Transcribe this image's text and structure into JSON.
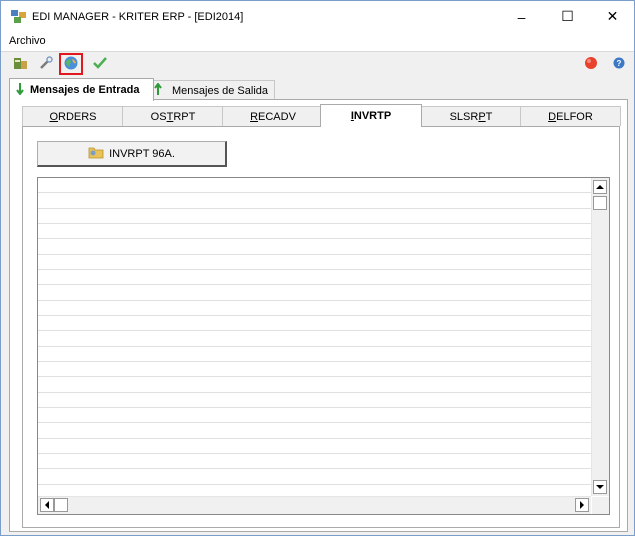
{
  "window": {
    "title": "EDI MANAGER - KRITER ERP - [EDI2014]",
    "minimize": "–",
    "maximize": "☐",
    "close": "✕"
  },
  "menu": {
    "items": [
      {
        "label": "Archivo"
      }
    ]
  },
  "toolbar": {
    "buttons": [
      {
        "icon": "database-export-icon"
      },
      {
        "icon": "wrench-icon"
      },
      {
        "icon": "globe-refresh-icon",
        "highlighted": true
      },
      {
        "icon": "checkmark-icon"
      },
      {
        "icon": "red-record-icon"
      },
      {
        "icon": "help-icon"
      }
    ]
  },
  "outer_tabs": [
    {
      "label": "Mensajes de Entrada",
      "icon": "green-arrow-down-icon",
      "active": true
    },
    {
      "label": "Mensajes de Salida",
      "icon": "green-arrow-up-icon",
      "active": false
    }
  ],
  "inner_tabs": [
    {
      "label": "ORDERS",
      "mnemonic": "O",
      "rest": "RDERS",
      "active": false
    },
    {
      "label": "OSTRPT",
      "pre": "OS",
      "mnemonic": "T",
      "rest": "RPT",
      "active": false
    },
    {
      "label": "RECADV",
      "mnemonic": "R",
      "rest": "ECADV",
      "active": false
    },
    {
      "label": "INVRTP",
      "pre": "",
      "mnemonic": "I",
      "rest": "NVRTP",
      "active": true
    },
    {
      "label": "SLSRPT",
      "pre": "SLSR",
      "mnemonic": "P",
      "rest": "T",
      "active": false
    },
    {
      "label": "DELFOR",
      "mnemonic": "D",
      "rest": "ELFOR",
      "active": false
    }
  ],
  "action_button": {
    "label": "INVRPT 96A.",
    "icon": "folder-process-icon"
  },
  "colors": {
    "highlight": "#e0191f",
    "accent_green": "#2e9a3a"
  }
}
